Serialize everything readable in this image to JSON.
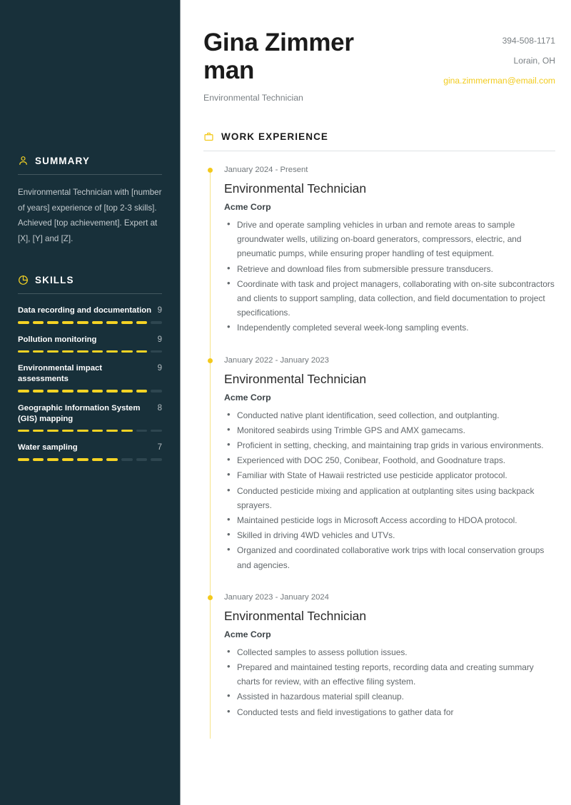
{
  "header": {
    "name": "Gina Zimmerman",
    "job_title": "Environmental Technician",
    "phone": "394-508-1171",
    "location": "Lorain, OH",
    "email": "gina.zimmerman@email.com"
  },
  "colors": {
    "sidebar_bg": "#18303a",
    "accent": "#f5d324",
    "email": "#f2cb1d",
    "timeline_line": "#f7e48a",
    "body_text": "#61676b"
  },
  "sidebar": {
    "summary": {
      "icon": "person-icon",
      "title": "SUMMARY",
      "text": "Environmental Technician with [number of years] experience of [top 2-3 skills]. Achieved [top achievement]. Expert at [X], [Y] and [Z]."
    },
    "skills": {
      "icon": "pie-chart-icon",
      "title": "SKILLS",
      "max": 10,
      "items": [
        {
          "name": "Data recording and documentation",
          "value": 9
        },
        {
          "name": "Pollution monitoring",
          "value": 9
        },
        {
          "name": "Environmental impact assessments",
          "value": 9
        },
        {
          "name": "Geographic Information System (GIS) mapping",
          "value": 8
        },
        {
          "name": "Water sampling",
          "value": 7
        }
      ]
    }
  },
  "work_experience": {
    "icon": "briefcase-icon",
    "title": "WORK EXPERIENCE",
    "jobs": [
      {
        "dates": "January 2024 - Present",
        "role": "Environmental Technician",
        "company": "Acme Corp",
        "bullets": [
          "Drive and operate sampling vehicles in urban and remote areas to sample groundwater wells, utilizing on-board generators, compressors, electric, and pneumatic pumps, while ensuring proper handling of test equipment.",
          "Retrieve and download files from submersible pressure transducers.",
          "Coordinate with task and project managers, collaborating with on-site subcontractors and clients to support sampling, data collection, and field documentation to project specifications.",
          "Independently completed several week-long sampling events."
        ]
      },
      {
        "dates": "January 2022 - January 2023",
        "role": "Environmental Technician",
        "company": "Acme Corp",
        "bullets": [
          "Conducted native plant identification, seed collection, and outplanting.",
          "Monitored seabirds using Trimble GPS and AMX gamecams.",
          "Proficient in setting, checking, and maintaining trap grids in various environments.",
          "Experienced with DOC 250, Conibear, Foothold, and Goodnature traps.",
          "Familiar with State of Hawaii restricted use pesticide applicator protocol.",
          "Conducted pesticide mixing and application at outplanting sites using backpack sprayers.",
          "Maintained pesticide logs in Microsoft Access according to HDOA protocol.",
          "Skilled in driving 4WD vehicles and UTVs.",
          "Organized and coordinated collaborative work trips with local conservation groups and agencies."
        ]
      },
      {
        "dates": "January 2023 - January 2024",
        "role": "Environmental Technician",
        "company": "Acme Corp",
        "bullets": [
          "Collected samples to assess pollution issues.",
          "Prepared and maintained testing reports, recording data and creating summary charts for review, with an effective filing system.",
          "Assisted in hazardous material spill cleanup.",
          "Conducted tests and field investigations to gather data for"
        ]
      }
    ]
  }
}
